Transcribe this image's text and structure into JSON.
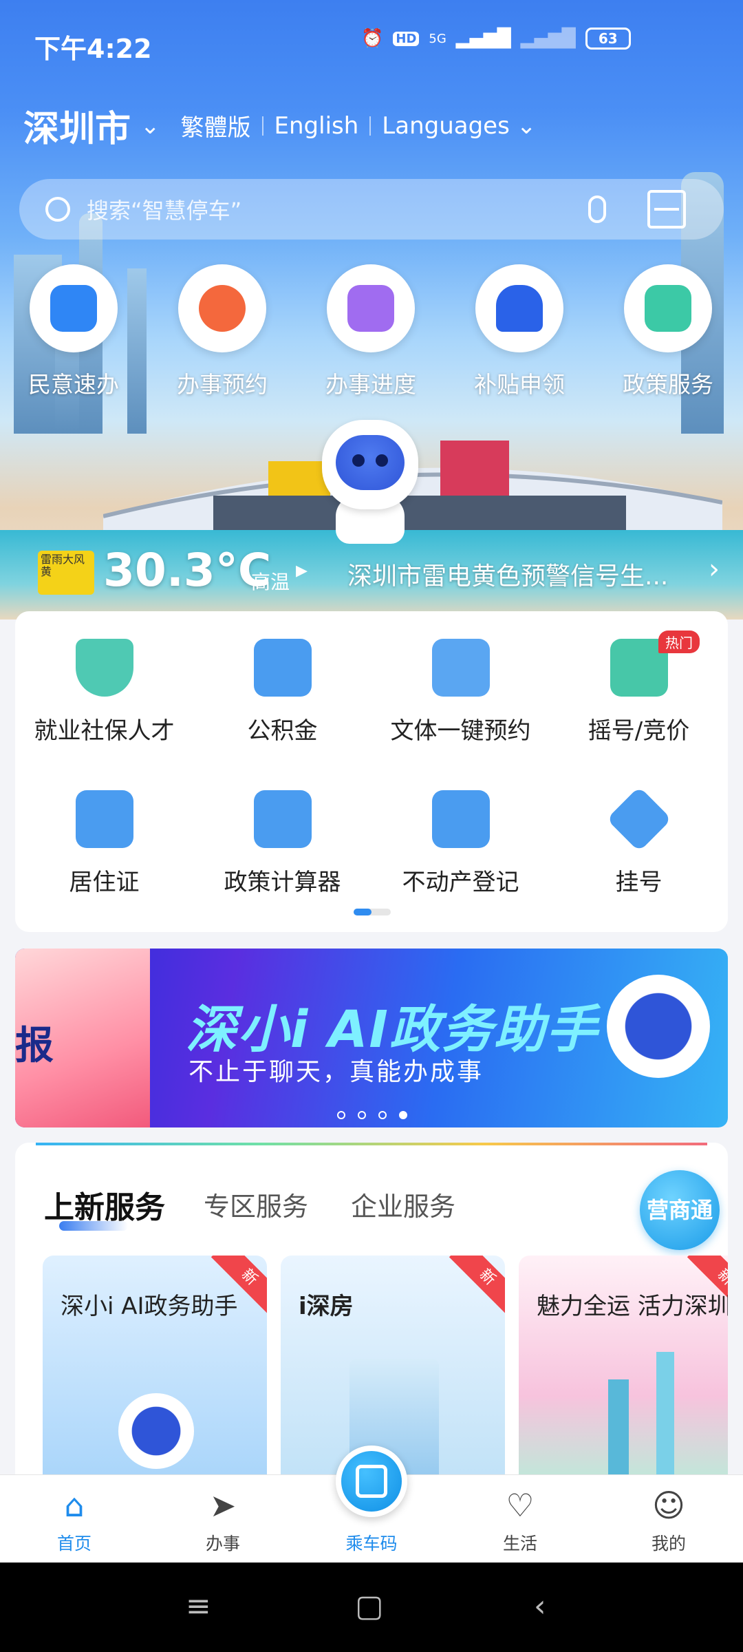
{
  "status": {
    "time": "下午4:22",
    "hd": "HD",
    "net": "5G",
    "battery": "63"
  },
  "header": {
    "city": "深圳市",
    "langs": [
      "繁體版",
      "English",
      "Languages"
    ]
  },
  "search": {
    "placeholder": "搜索“智慧停车”"
  },
  "quick_actions": [
    {
      "label": "民意速办",
      "icon": "chat-icon",
      "color": "#2f86f5"
    },
    {
      "label": "办事预约",
      "icon": "alarm-clock-icon",
      "color": "#f4683d"
    },
    {
      "label": "办事进度",
      "icon": "progress-arrow-icon",
      "color": "#a06cf0"
    },
    {
      "label": "补贴申领",
      "icon": "train-icon",
      "color": "#2a62e8"
    },
    {
      "label": "政策服务",
      "icon": "policy-doc-icon",
      "color": "#3cc9a6"
    }
  ],
  "weather": {
    "badge_top": "雷雨大风",
    "badge_level": "黄",
    "temp": "30.3°C",
    "note": "高温",
    "warning": "深圳市雷电黄色预警信号生..."
  },
  "services": [
    {
      "label": "就业社保人才",
      "icon": "shield-check-icon",
      "color": "#4fc9b3"
    },
    {
      "label": "公积金",
      "icon": "house-yen-icon",
      "color": "#4a9cf0"
    },
    {
      "label": "文体一键预约",
      "icon": "star-badge-icon",
      "color": "#5aa6f2"
    },
    {
      "label": "摇号/竞价",
      "icon": "car-icon",
      "color": "#47c7a8",
      "badge": "热门"
    },
    {
      "label": "居住证",
      "icon": "id-card-icon",
      "color": "#4a9cf0"
    },
    {
      "label": "政策计算器",
      "icon": "calculator-icon",
      "color": "#4a9cf0"
    },
    {
      "label": "不动产登记",
      "icon": "property-house-icon",
      "color": "#4a9cf0"
    },
    {
      "label": "挂号",
      "icon": "medical-plus-icon",
      "color": "#4a9cf0"
    }
  ],
  "banner": {
    "title": "深小i AI政务助手",
    "subtitle": "不止于聊天，真能办成事",
    "left_text": "报",
    "dots_total": 4,
    "dots_active": 4
  },
  "new_services": {
    "tabs": [
      "上新服务",
      "专区服务",
      "企业服务"
    ],
    "float_button": "营商通",
    "cards": [
      {
        "title": "深小i AI政务助手",
        "ribbon": "新"
      },
      {
        "title": "i深房",
        "ribbon": "新"
      },
      {
        "title": "魅力全运 活力深圳",
        "ribbon": "新"
      }
    ]
  },
  "bottom_nav": [
    {
      "label": "首页",
      "icon": "home-icon",
      "active": true
    },
    {
      "label": "办事",
      "icon": "paper-plane-icon",
      "active": false
    },
    {
      "label": "乘车码",
      "icon": "bus-code-icon",
      "active": false
    },
    {
      "label": "生活",
      "icon": "heart-icon",
      "active": false
    },
    {
      "label": "我的",
      "icon": "user-icon",
      "active": false
    }
  ],
  "colors": {
    "brand": "#1f8cec",
    "hot": "#e8373d"
  }
}
